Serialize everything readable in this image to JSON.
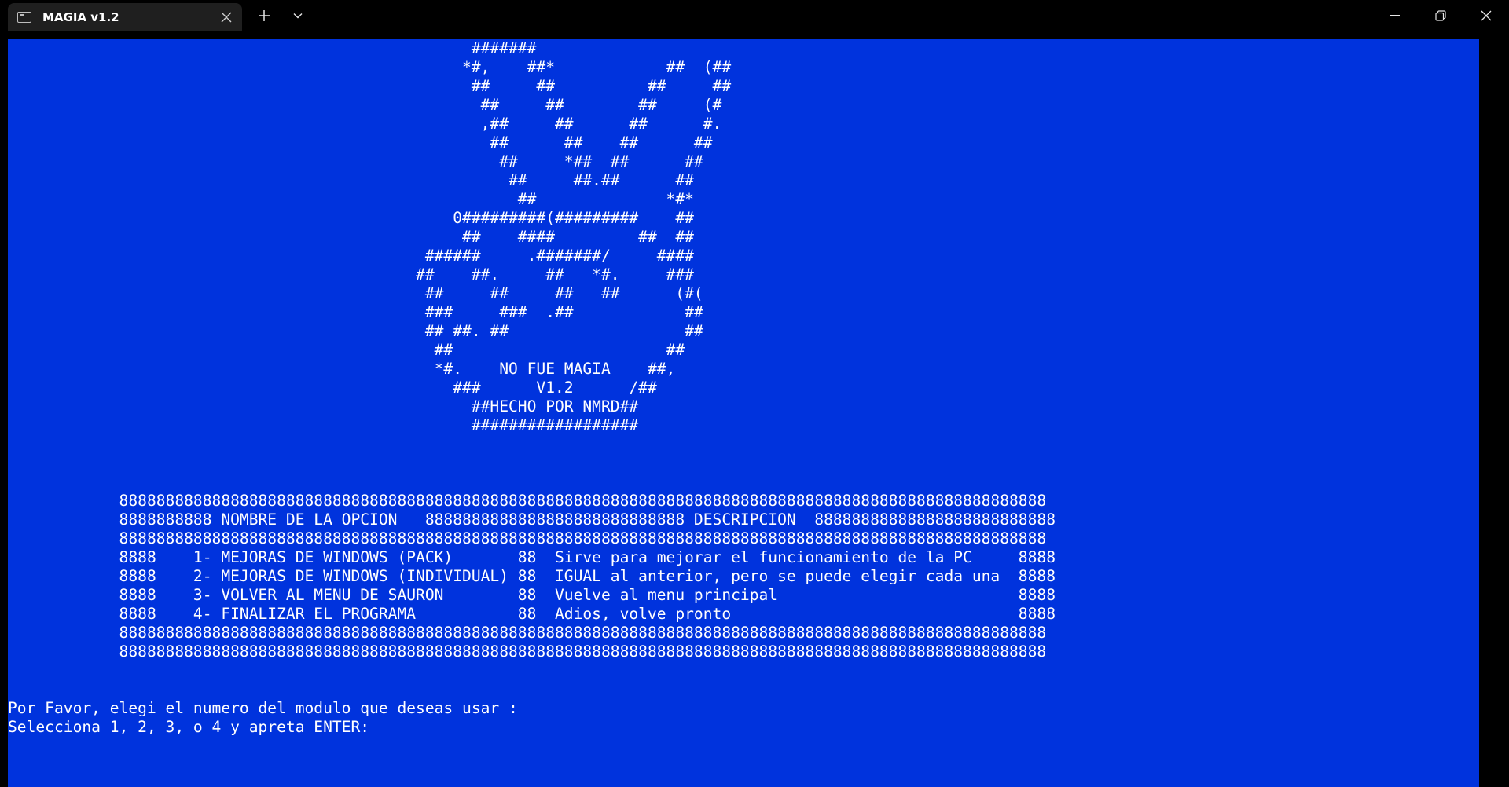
{
  "window": {
    "tab_title": "MAGIA v1.2",
    "tab_icon": "terminal-icon",
    "close_tab_icon": "close-icon",
    "new_tab_icon": "plus-icon",
    "dropdown_icon": "chevron-down-icon",
    "minimize_icon": "minimize-icon",
    "maximize_icon": "restore-icon",
    "close_icon": "close-icon"
  },
  "colors": {
    "console_background": "#0033dd",
    "console_text": "#ffffff",
    "titlebar": "#000000"
  },
  "console": {
    "ascii_art": [
      "                                                  #######",
      "                                                 *#,    ##*            ##  (##",
      "                                                  ##     ##          ##     ##",
      "                                                   ##     ##        ##     (#",
      "                                                   ,##     ##      ##      #.",
      "                                                    ##      ##    ##      ##",
      "                                                     ##     *##  ##      ##",
      "                                                      ##     ##.##      ##",
      "                                                       ##              *#*",
      "                                                0#########(#########    ##",
      "                                                 ##    ####         ##  ##",
      "                                             ######     .#######/     ####",
      "                                            ##    ##.     ##   *#.     ###",
      "                                             ##     ##     ##   ##      (#(",
      "                                             ###     ###  .##            ##",
      "                                             ## ##. ##                   ##",
      "                                              ##                       ##",
      "                                              *#.    NO FUE MAGIA    ##,",
      "                                                ###      V1.2      /##",
      "                                                  ##HECHO POR NMRD##",
      "                                                  ##################"
    ],
    "menu_table": [
      "            8888888888888888888888888888888888888888888888888888888888888888888888888888888888888888888888888888",
      "            8888888888 NOMBRE DE LA OPCION   8888888888888888888888888888 DESCRIPCION  88888888888888888888888888",
      "            8888888888888888888888888888888888888888888888888888888888888888888888888888888888888888888888888888",
      "            8888    1- MEJORAS DE WINDOWS (PACK)       88  Sirve para mejorar el funcionamiento de la PC     8888",
      "            8888    2- MEJORAS DE WINDOWS (INDIVIDUAL) 88  IGUAL al anterior, pero se puede elegir cada una  8888",
      "            8888    3- VOLVER AL MENU DE SAURON        88  Vuelve al menu principal                          8888",
      "            8888    4- FINALIZAR EL PROGRAMA           88  Adios, volve pronto                               8888",
      "            8888888888888888888888888888888888888888888888888888888888888888888888888888888888888888888888888888",
      "            8888888888888888888888888888888888888888888888888888888888888888888888888888888888888888888888888888"
    ],
    "prompt_line_1": "Por Favor, elegi el numero del modulo que deseas usar :",
    "prompt_line_2": "Selecciona 1, 2, 3, o 4 y apreta ENTER:"
  }
}
